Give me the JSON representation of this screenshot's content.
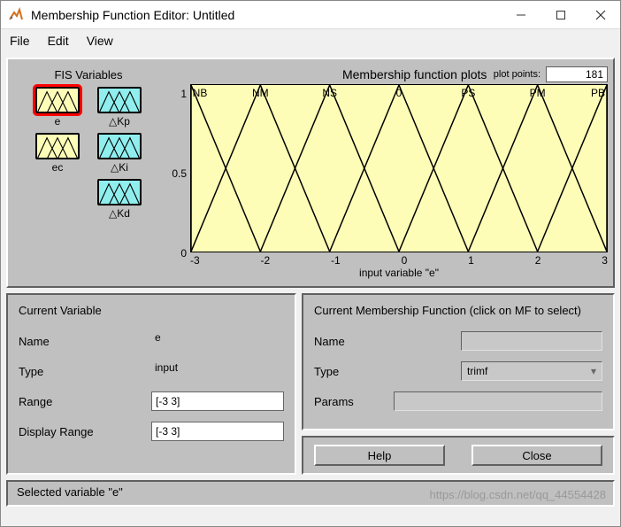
{
  "window": {
    "title": "Membership Function Editor: Untitled"
  },
  "menu": {
    "file": "File",
    "edit": "Edit",
    "view": "View"
  },
  "fis": {
    "title": "FIS Variables",
    "vars": [
      {
        "name": "e",
        "kind": "input",
        "selected": true
      },
      {
        "name": "△Kp",
        "kind": "output",
        "selected": false
      },
      {
        "name": "ec",
        "kind": "input",
        "selected": false
      },
      {
        "name": "△Ki",
        "kind": "output",
        "selected": false
      },
      {
        "name": "",
        "kind": "none",
        "selected": false
      },
      {
        "name": "△Kd",
        "kind": "output",
        "selected": false
      }
    ]
  },
  "plot": {
    "title": "Membership function plots",
    "plot_points_label": "plot points:",
    "plot_points": "181",
    "xlabel": "input variable \"e\"",
    "yticks": [
      "1",
      "0.5",
      "0"
    ],
    "xticks": [
      "-3",
      "-2",
      "-1",
      "0",
      "1",
      "2",
      "3"
    ]
  },
  "chart_data": {
    "type": "line",
    "title": "Membership function plots",
    "xlabel": "input variable \"e\"",
    "ylabel": "",
    "xlim": [
      -3,
      3
    ],
    "ylim": [
      0,
      1
    ],
    "x": [
      -3,
      -2,
      -1,
      0,
      1,
      2,
      3
    ],
    "series": [
      {
        "name": "NB",
        "shape": "trimf",
        "params": [
          -4,
          -3,
          -2
        ],
        "peak_x": -3
      },
      {
        "name": "NM",
        "shape": "trimf",
        "params": [
          -3,
          -2,
          -1
        ],
        "peak_x": -2
      },
      {
        "name": "NS",
        "shape": "trimf",
        "params": [
          -2,
          -1,
          0
        ],
        "peak_x": -1
      },
      {
        "name": "0",
        "shape": "trimf",
        "params": [
          -1,
          0,
          1
        ],
        "peak_x": 0
      },
      {
        "name": "PS",
        "shape": "trimf",
        "params": [
          0,
          1,
          2
        ],
        "peak_x": 1
      },
      {
        "name": "PM",
        "shape": "trimf",
        "params": [
          1,
          2,
          3
        ],
        "peak_x": 2
      },
      {
        "name": "PB",
        "shape": "trimf",
        "params": [
          2,
          3,
          4
        ],
        "peak_x": 3
      }
    ]
  },
  "curvar": {
    "title": "Current Variable",
    "name_label": "Name",
    "name": "e",
    "type_label": "Type",
    "type": "input",
    "range_label": "Range",
    "range": "[-3 3]",
    "disp_label": "Display Range",
    "disp": "[-3 3]"
  },
  "cmf": {
    "title": "Current Membership Function (click on MF to select)",
    "name_label": "Name",
    "name": "",
    "type_label": "Type",
    "type": "trimf",
    "params_label": "Params",
    "params": ""
  },
  "buttons": {
    "help": "Help",
    "close": "Close"
  },
  "status": "Selected variable \"e\"",
  "watermark": "https://blog.csdn.net/qq_44554428"
}
